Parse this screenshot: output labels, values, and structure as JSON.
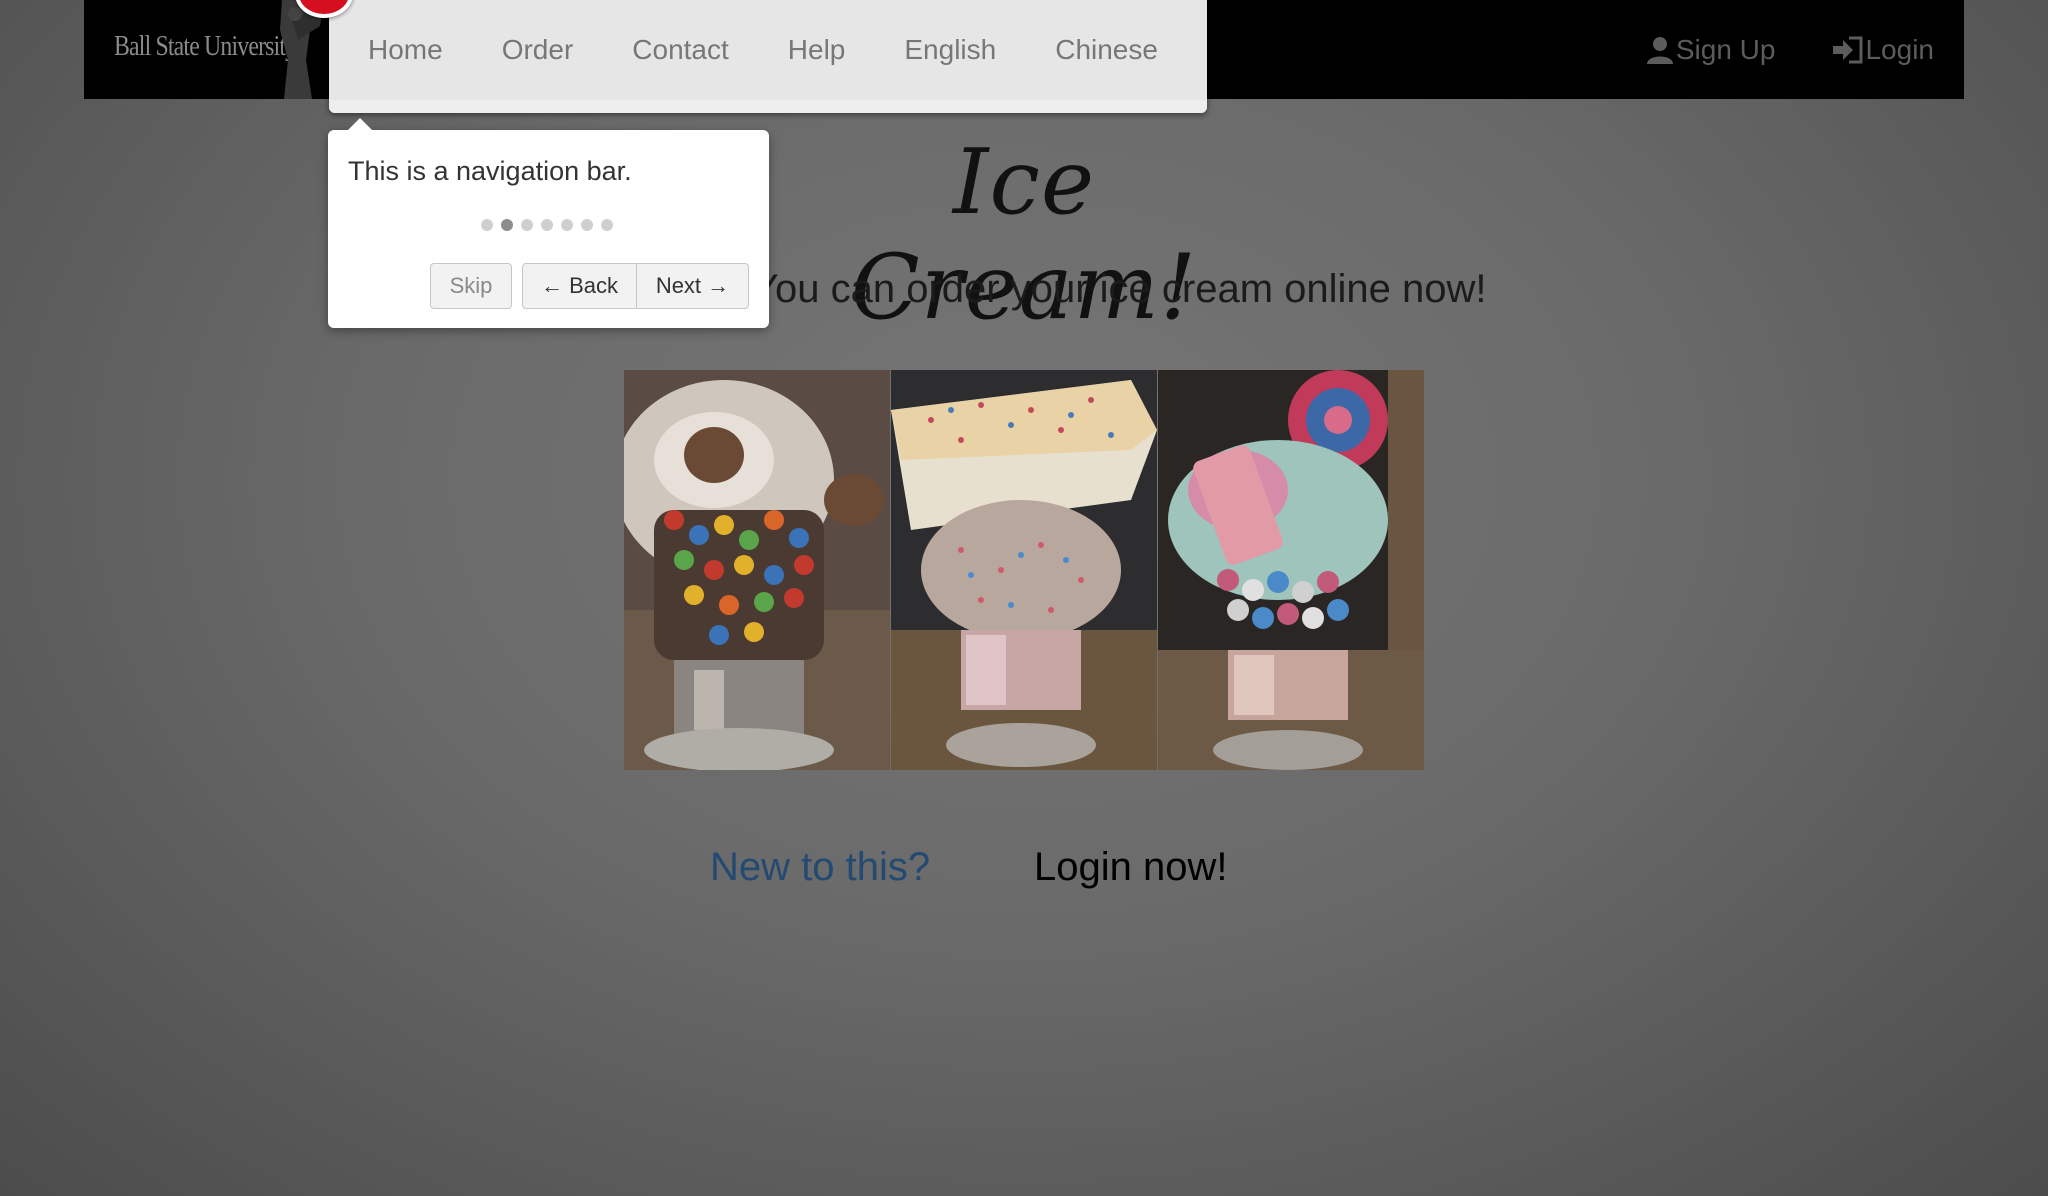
{
  "navbar": {
    "brand": "Ball State University",
    "menu": [
      "Home",
      "Order",
      "Contact",
      "Help",
      "English",
      "Chinese"
    ],
    "signup_label": "Sign Up",
    "login_label": "Login"
  },
  "tour": {
    "message": "This is a navigation bar.",
    "step_count": 7,
    "active_step": 2,
    "skip_label": "Skip",
    "back_label": "← Back",
    "next_label": "Next →"
  },
  "main": {
    "title": "Ice Cream!",
    "subtitle": "You can order your ice cream online now!",
    "cta_new": "New to this?",
    "cta_login": "Login now!"
  },
  "colors": {
    "tour_badge": "#d50f1f",
    "link": "#234a72"
  }
}
